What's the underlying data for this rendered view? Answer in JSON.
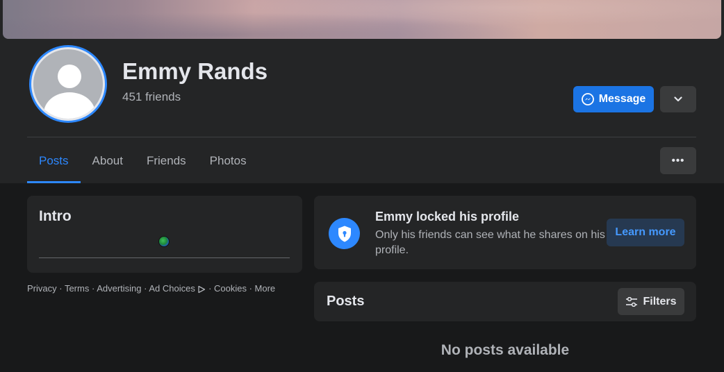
{
  "profile": {
    "name": "Emmy Rands",
    "friends_count": "451 friends",
    "message_label": "Message"
  },
  "tabs": [
    {
      "label": "Posts",
      "active": true
    },
    {
      "label": "About",
      "active": false
    },
    {
      "label": "Friends",
      "active": false
    },
    {
      "label": "Photos",
      "active": false
    }
  ],
  "more_dots": "•••",
  "intro": {
    "title": "Intro"
  },
  "footer": {
    "privacy": "Privacy",
    "terms": "Terms",
    "advertising": "Advertising",
    "ad_choices": "Ad Choices",
    "cookies": "Cookies",
    "more": "More",
    "separator": " · "
  },
  "locked": {
    "title": "Emmy locked his profile",
    "description": "Only his friends can see what he shares on his profile.",
    "learn_more": "Learn more"
  },
  "posts": {
    "title": "Posts",
    "filters_label": "Filters",
    "empty_text": "No posts available"
  },
  "colors": {
    "accent": "#2d88ff",
    "message_button": "#1b74e4",
    "background": "#18191a",
    "card": "#242526"
  },
  "icons": {
    "message": "messenger-icon",
    "dropdown": "chevron-down-icon",
    "lock": "shield-lock-icon",
    "filters": "sliders-icon",
    "globe": "globe-icon",
    "ad_choices": "ad-choices-icon"
  }
}
